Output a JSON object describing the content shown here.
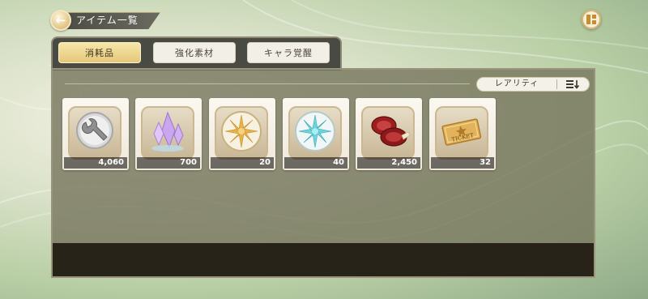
{
  "header": {
    "title": "アイテム一覧"
  },
  "tabs": [
    {
      "label": "消耗品",
      "active": true
    },
    {
      "label": "強化素材",
      "active": false
    },
    {
      "label": "キャラ覚醒",
      "active": false
    }
  ],
  "sort": {
    "label": "レアリティ"
  },
  "items": [
    {
      "icon": "wrench-icon",
      "count": "4,060"
    },
    {
      "icon": "crystal-icon",
      "count": "700"
    },
    {
      "icon": "gold-medal-icon",
      "count": "20"
    },
    {
      "icon": "cyan-medal-icon",
      "count": "40"
    },
    {
      "icon": "steak-icon",
      "count": "2,450"
    },
    {
      "icon": "ticket-icon",
      "count": "32",
      "icon_text": "TICKET"
    }
  ],
  "colors": {
    "tab_active": "#e5c77a",
    "panel": "#76745c",
    "footer": "#272318"
  }
}
